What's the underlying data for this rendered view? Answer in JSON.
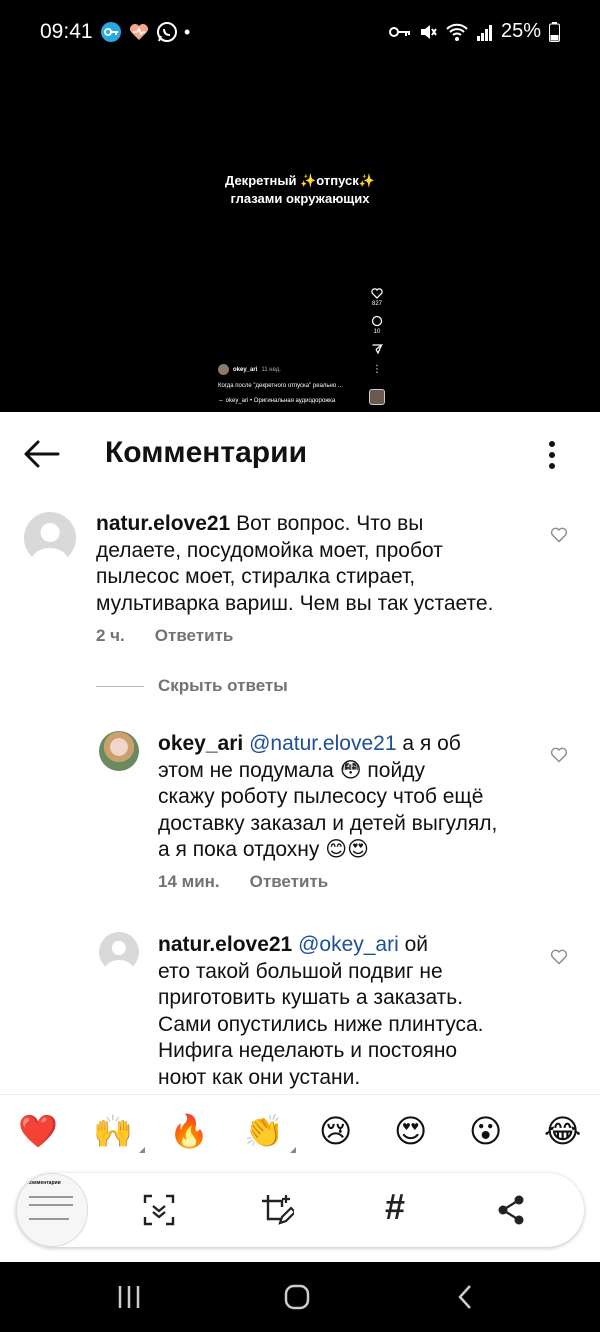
{
  "status_bar": {
    "time": "09:41",
    "battery": "25%",
    "left_icons": [
      "key-app-icon",
      "heart-app-icon",
      "whatsapp-icon"
    ],
    "right_icons": [
      "key-icon",
      "mute-icon",
      "wifi-icon",
      "signal-icon",
      "battery-icon"
    ]
  },
  "video": {
    "caption_line1": "Декретный ✨отпуск✨",
    "caption_line2": "глазами окружающих",
    "likes": "827",
    "comments": "10",
    "username": "okey_ari",
    "time_ago": "11 нед.",
    "description": "Когда после \"декретного отпуска\" реально ...",
    "audio": "⇔ okey_ari • Оригинальная аудиодорожка"
  },
  "header": {
    "title": "Комментарии"
  },
  "comments": [
    {
      "username": "natur.elove21",
      "text_lines": [
        "Вот вопрос. Что вы",
        "делаете, посудомойка моет, пробот",
        "пылесос моет, стиралка стирает,",
        "мультиварка вариш. Чем вы так устаете."
      ],
      "time": "2 ч.",
      "reply_label": "Ответить"
    }
  ],
  "hide_replies_label": "Скрыть ответы",
  "replies": [
    {
      "username": "okey_ari",
      "mention": "@natur.elove21",
      "text_lines": [
        "а я об",
        "этом не подумала 😳 пойду",
        "скажу роботу пылесосу чтоб ещё",
        "доставку заказал и детей выгулял,",
        "а я пока отдохну 😊😍"
      ],
      "time": "14 мин.",
      "reply_label": "Ответить"
    },
    {
      "username": "natur.elove21",
      "mention": "@okey_ari",
      "text_lines": [
        "ой",
        "ето такой большой подвиг не",
        "приготовить кушать а заказать.",
        "Сами опустились ниже плинтуса.",
        "Нифига неделають и постояно",
        "ноют как они устани."
      ]
    }
  ],
  "emoji_reactions": [
    "❤️",
    "🙌",
    "🔥",
    "👏",
    "😢",
    "😍",
    "😮",
    "😂"
  ],
  "screenshot_toolbar": {
    "thumbnail_title": "Комментарии",
    "buttons": [
      "scroll-capture-icon",
      "crop-edit-icon",
      "hashtag-icon",
      "share-icon"
    ],
    "hashtag_label": "#"
  },
  "colors": {
    "mention": "#1d4f9a",
    "muted": "#737373",
    "heart_red": "#e0245e"
  }
}
